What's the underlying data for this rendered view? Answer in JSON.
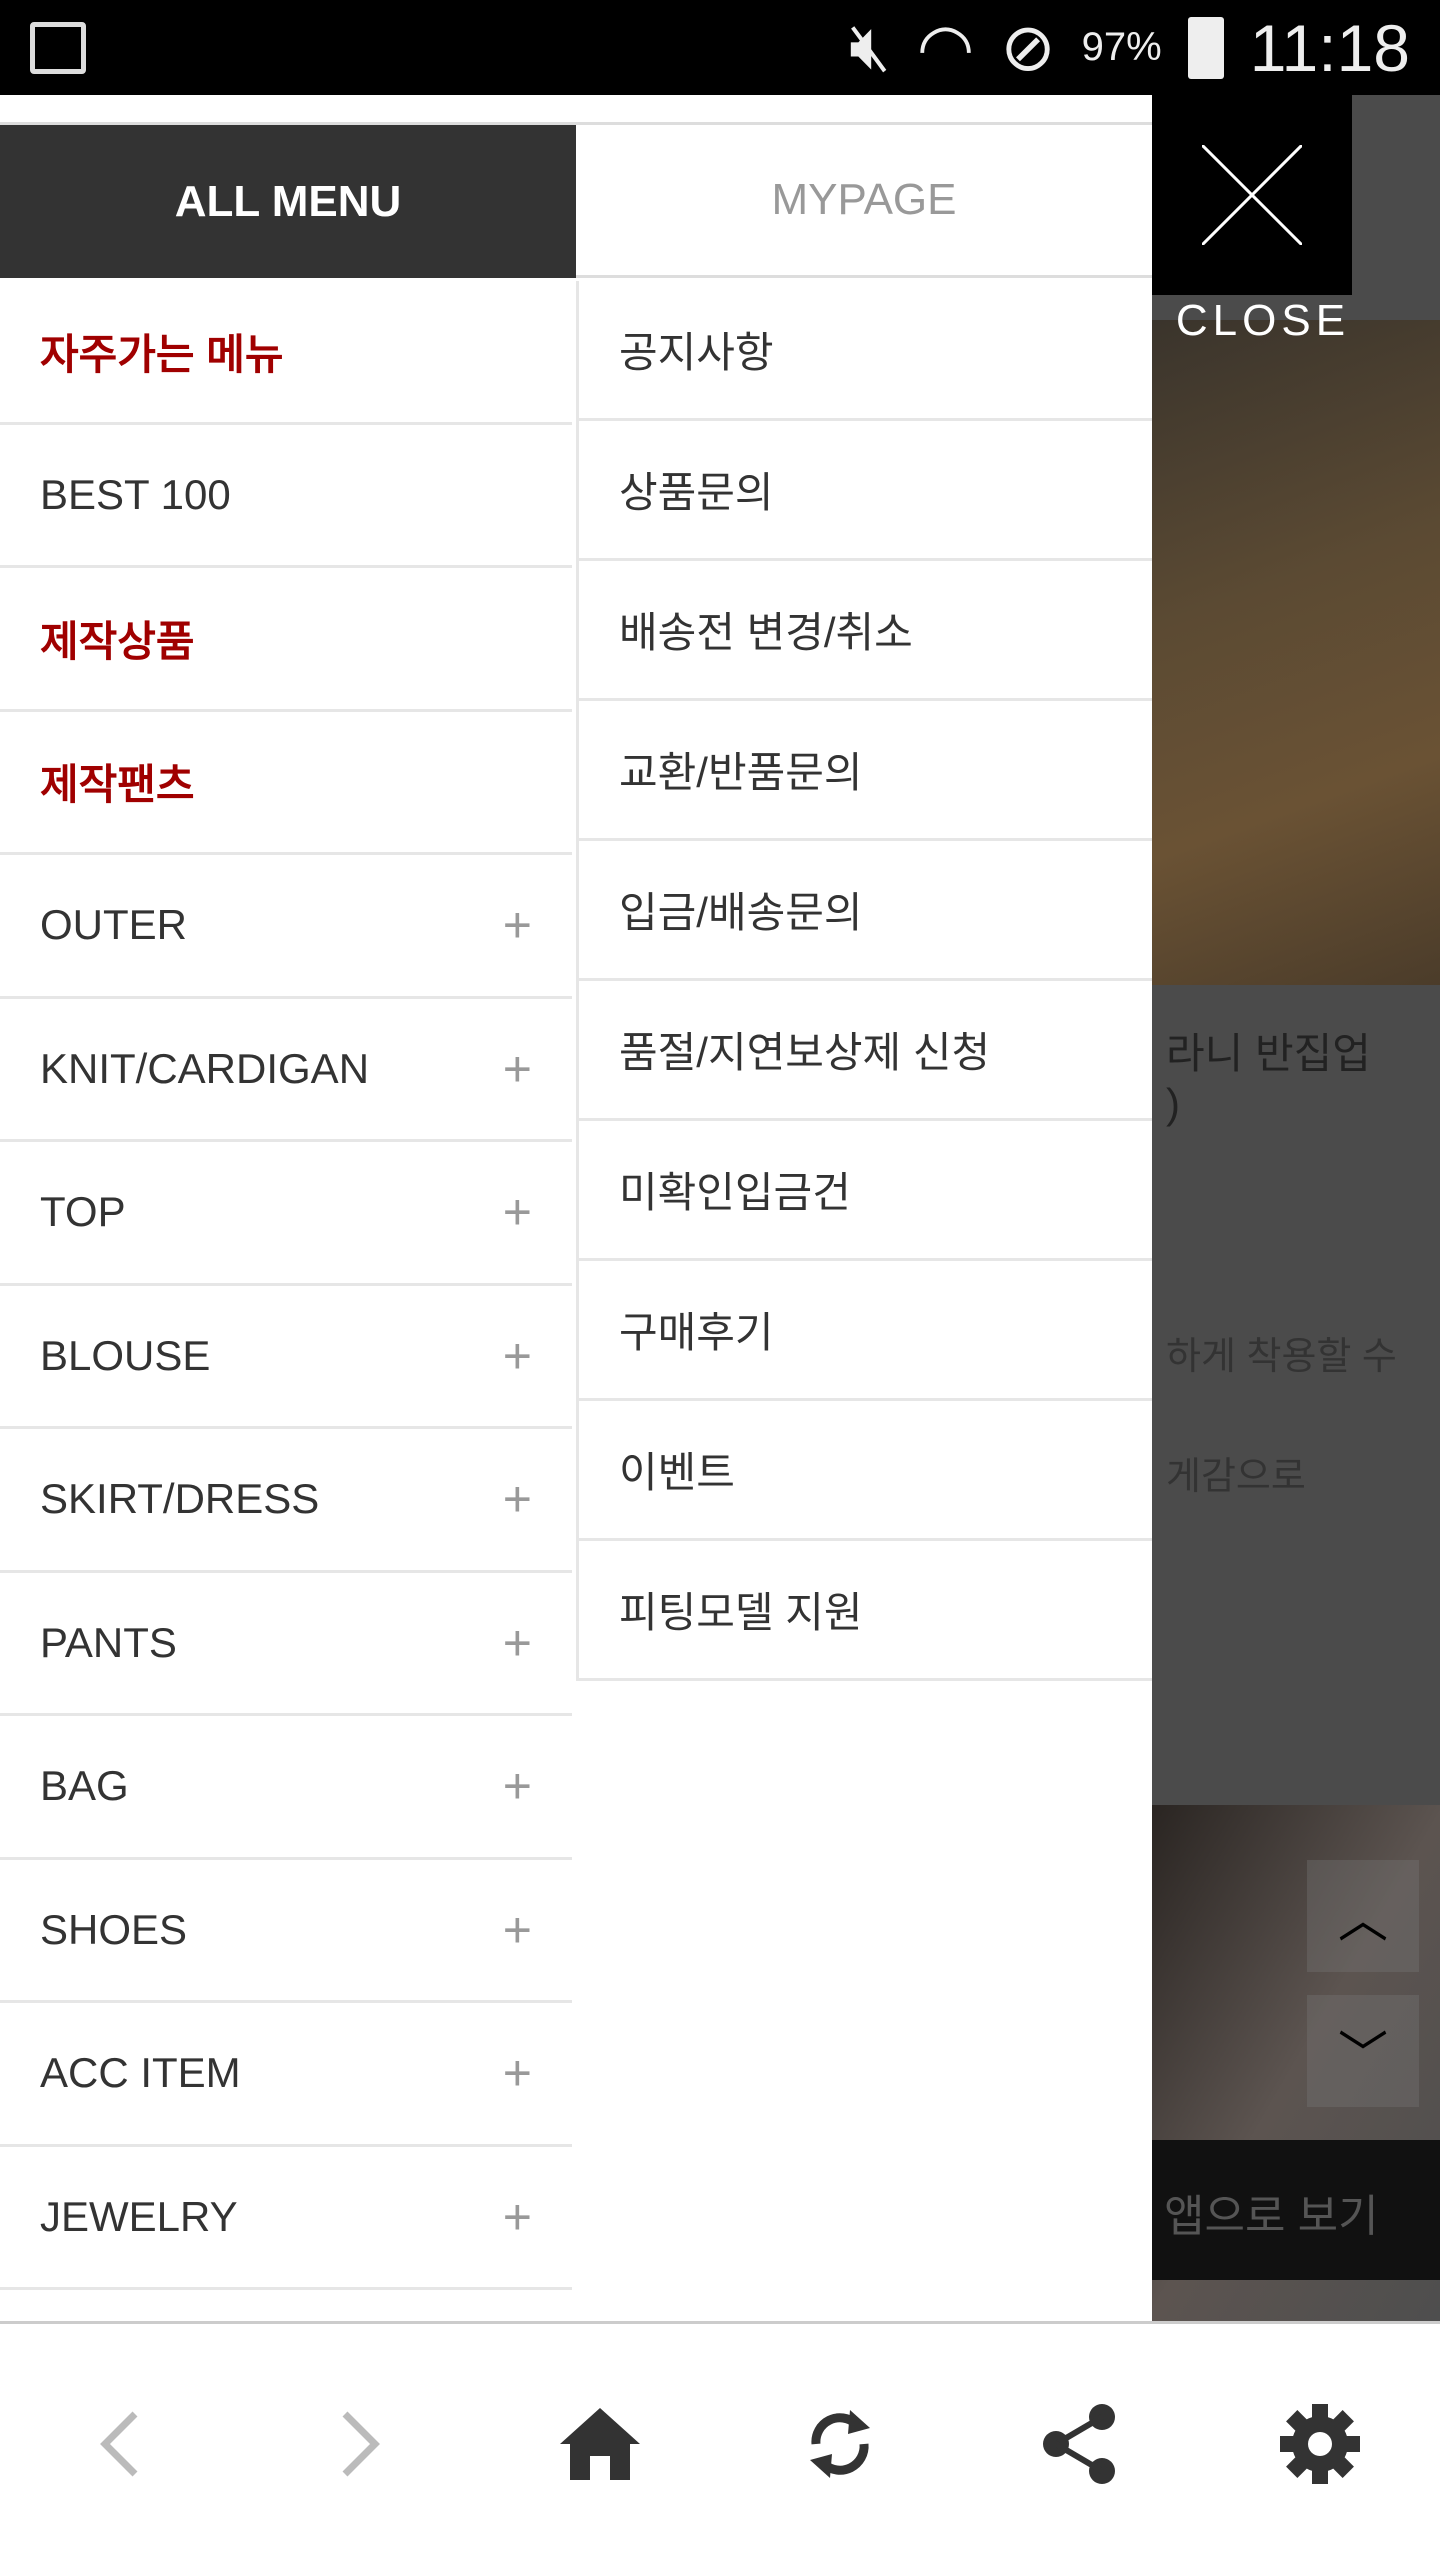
{
  "status_bar": {
    "battery": "97%",
    "time": "11:18"
  },
  "tabs": {
    "all_menu": "ALL MENU",
    "mypage": "MYPAGE"
  },
  "close": {
    "label": "CLOSE"
  },
  "left_menu": [
    {
      "label": "자주가는 메뉴",
      "highlight": true,
      "expandable": false
    },
    {
      "label": "BEST 100",
      "highlight": false,
      "expandable": false
    },
    {
      "label": "제작상품",
      "highlight": true,
      "expandable": false
    },
    {
      "label": "제작팬츠",
      "highlight": true,
      "expandable": false
    },
    {
      "label": "OUTER",
      "highlight": false,
      "expandable": true
    },
    {
      "label": "KNIT/CARDIGAN",
      "highlight": false,
      "expandable": true
    },
    {
      "label": "TOP",
      "highlight": false,
      "expandable": true
    },
    {
      "label": "BLOUSE",
      "highlight": false,
      "expandable": true
    },
    {
      "label": "SKIRT/DRESS",
      "highlight": false,
      "expandable": true
    },
    {
      "label": "PANTS",
      "highlight": false,
      "expandable": true
    },
    {
      "label": "BAG",
      "highlight": false,
      "expandable": true
    },
    {
      "label": "SHOES",
      "highlight": false,
      "expandable": true
    },
    {
      "label": "ACC ITEM",
      "highlight": false,
      "expandable": true
    },
    {
      "label": "JEWELRY",
      "highlight": false,
      "expandable": true
    }
  ],
  "plus_symbol": "+",
  "right_menu": [
    "공지사항",
    "상품문의",
    "배송전 변경/취소",
    "교환/반품문의",
    "입금/배송문의",
    "품절/지연보상제 신청",
    "미확인입금건",
    "구매후기",
    "이벤트",
    "피팅모델 지원"
  ],
  "background": {
    "title_line1": "라니 반집업",
    "title_line2": ")",
    "desc_line1": "하게 착용할 수",
    "desc_line2": "게감으로",
    "app_view": "앱으로 보기"
  },
  "colors": {
    "accent_red": "#a00000",
    "active_tab": "#333333"
  }
}
